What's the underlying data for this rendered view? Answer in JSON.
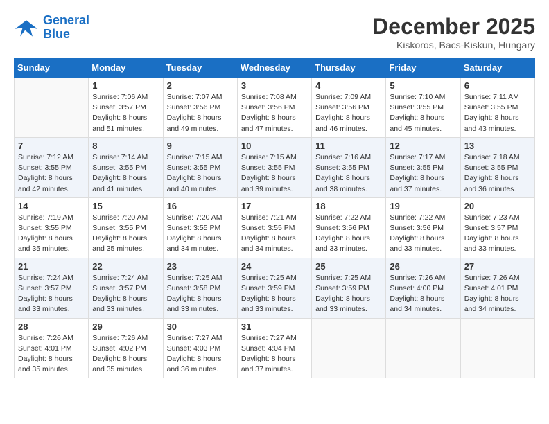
{
  "logo": {
    "line1": "General",
    "line2": "Blue"
  },
  "title": {
    "month_year": "December 2025",
    "location": "Kiskoros, Bacs-Kiskun, Hungary"
  },
  "weekdays": [
    "Sunday",
    "Monday",
    "Tuesday",
    "Wednesday",
    "Thursday",
    "Friday",
    "Saturday"
  ],
  "weeks": [
    [
      {
        "day": "",
        "info": ""
      },
      {
        "day": "1",
        "info": "Sunrise: 7:06 AM\nSunset: 3:57 PM\nDaylight: 8 hours\nand 51 minutes."
      },
      {
        "day": "2",
        "info": "Sunrise: 7:07 AM\nSunset: 3:56 PM\nDaylight: 8 hours\nand 49 minutes."
      },
      {
        "day": "3",
        "info": "Sunrise: 7:08 AM\nSunset: 3:56 PM\nDaylight: 8 hours\nand 47 minutes."
      },
      {
        "day": "4",
        "info": "Sunrise: 7:09 AM\nSunset: 3:56 PM\nDaylight: 8 hours\nand 46 minutes."
      },
      {
        "day": "5",
        "info": "Sunrise: 7:10 AM\nSunset: 3:55 PM\nDaylight: 8 hours\nand 45 minutes."
      },
      {
        "day": "6",
        "info": "Sunrise: 7:11 AM\nSunset: 3:55 PM\nDaylight: 8 hours\nand 43 minutes."
      }
    ],
    [
      {
        "day": "7",
        "info": "Sunrise: 7:12 AM\nSunset: 3:55 PM\nDaylight: 8 hours\nand 42 minutes."
      },
      {
        "day": "8",
        "info": "Sunrise: 7:14 AM\nSunset: 3:55 PM\nDaylight: 8 hours\nand 41 minutes."
      },
      {
        "day": "9",
        "info": "Sunrise: 7:15 AM\nSunset: 3:55 PM\nDaylight: 8 hours\nand 40 minutes."
      },
      {
        "day": "10",
        "info": "Sunrise: 7:15 AM\nSunset: 3:55 PM\nDaylight: 8 hours\nand 39 minutes."
      },
      {
        "day": "11",
        "info": "Sunrise: 7:16 AM\nSunset: 3:55 PM\nDaylight: 8 hours\nand 38 minutes."
      },
      {
        "day": "12",
        "info": "Sunrise: 7:17 AM\nSunset: 3:55 PM\nDaylight: 8 hours\nand 37 minutes."
      },
      {
        "day": "13",
        "info": "Sunrise: 7:18 AM\nSunset: 3:55 PM\nDaylight: 8 hours\nand 36 minutes."
      }
    ],
    [
      {
        "day": "14",
        "info": "Sunrise: 7:19 AM\nSunset: 3:55 PM\nDaylight: 8 hours\nand 35 minutes."
      },
      {
        "day": "15",
        "info": "Sunrise: 7:20 AM\nSunset: 3:55 PM\nDaylight: 8 hours\nand 35 minutes."
      },
      {
        "day": "16",
        "info": "Sunrise: 7:20 AM\nSunset: 3:55 PM\nDaylight: 8 hours\nand 34 minutes."
      },
      {
        "day": "17",
        "info": "Sunrise: 7:21 AM\nSunset: 3:55 PM\nDaylight: 8 hours\nand 34 minutes."
      },
      {
        "day": "18",
        "info": "Sunrise: 7:22 AM\nSunset: 3:56 PM\nDaylight: 8 hours\nand 33 minutes."
      },
      {
        "day": "19",
        "info": "Sunrise: 7:22 AM\nSunset: 3:56 PM\nDaylight: 8 hours\nand 33 minutes."
      },
      {
        "day": "20",
        "info": "Sunrise: 7:23 AM\nSunset: 3:57 PM\nDaylight: 8 hours\nand 33 minutes."
      }
    ],
    [
      {
        "day": "21",
        "info": "Sunrise: 7:24 AM\nSunset: 3:57 PM\nDaylight: 8 hours\nand 33 minutes."
      },
      {
        "day": "22",
        "info": "Sunrise: 7:24 AM\nSunset: 3:57 PM\nDaylight: 8 hours\nand 33 minutes."
      },
      {
        "day": "23",
        "info": "Sunrise: 7:25 AM\nSunset: 3:58 PM\nDaylight: 8 hours\nand 33 minutes."
      },
      {
        "day": "24",
        "info": "Sunrise: 7:25 AM\nSunset: 3:59 PM\nDaylight: 8 hours\nand 33 minutes."
      },
      {
        "day": "25",
        "info": "Sunrise: 7:25 AM\nSunset: 3:59 PM\nDaylight: 8 hours\nand 33 minutes."
      },
      {
        "day": "26",
        "info": "Sunrise: 7:26 AM\nSunset: 4:00 PM\nDaylight: 8 hours\nand 34 minutes."
      },
      {
        "day": "27",
        "info": "Sunrise: 7:26 AM\nSunset: 4:01 PM\nDaylight: 8 hours\nand 34 minutes."
      }
    ],
    [
      {
        "day": "28",
        "info": "Sunrise: 7:26 AM\nSunset: 4:01 PM\nDaylight: 8 hours\nand 35 minutes."
      },
      {
        "day": "29",
        "info": "Sunrise: 7:26 AM\nSunset: 4:02 PM\nDaylight: 8 hours\nand 35 minutes."
      },
      {
        "day": "30",
        "info": "Sunrise: 7:27 AM\nSunset: 4:03 PM\nDaylight: 8 hours\nand 36 minutes."
      },
      {
        "day": "31",
        "info": "Sunrise: 7:27 AM\nSunset: 4:04 PM\nDaylight: 8 hours\nand 37 minutes."
      },
      {
        "day": "",
        "info": ""
      },
      {
        "day": "",
        "info": ""
      },
      {
        "day": "",
        "info": ""
      }
    ]
  ]
}
